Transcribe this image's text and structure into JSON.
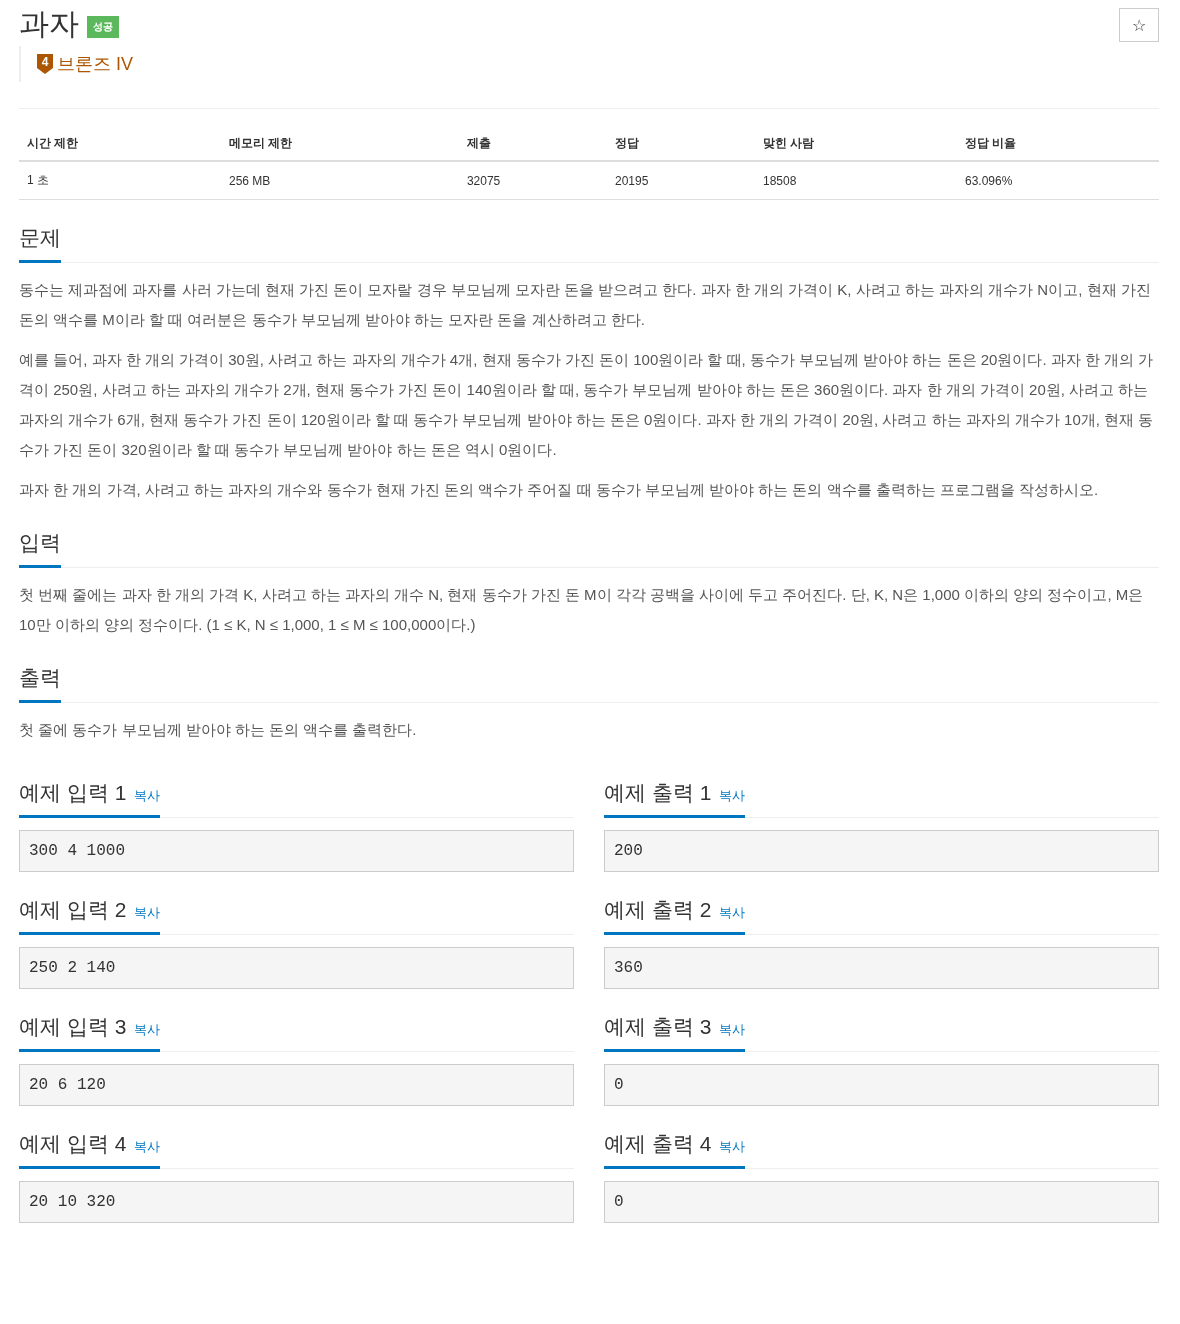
{
  "title": "과자",
  "result_badge": "성공",
  "tier": {
    "number": "4",
    "label": "브론즈 IV"
  },
  "star_button": "☆",
  "stats": {
    "columns": [
      "시간 제한",
      "메모리 제한",
      "제출",
      "정답",
      "맞힌 사람",
      "정답 비율"
    ],
    "row": [
      "1 초",
      "256 MB",
      "32075",
      "20195",
      "18508",
      "63.096%"
    ]
  },
  "sections": [
    {
      "heading": "문제",
      "paragraphs": [
        "동수는 제과점에 과자를 사러 가는데 현재 가진 돈이 모자랄 경우 부모님께 모자란 돈을 받으려고 한다. 과자 한 개의 가격이 K, 사려고 하는 과자의 개수가 N이고, 현재 가진 돈의 액수를 M이라 할 때 여러분은 동수가 부모님께 받아야 하는 모자란 돈을 계산하려고 한다.",
        "예를 들어, 과자 한 개의 가격이 30원, 사려고 하는 과자의 개수가 4개, 현재 동수가 가진 돈이 100원이라 할 때, 동수가 부모님께 받아야 하는 돈은 20원이다. 과자 한 개의 가격이 250원, 사려고 하는 과자의 개수가 2개, 현재 동수가 가진 돈이 140원이라 할 때, 동수가 부모님께 받아야 하는 돈은 360원이다. 과자 한 개의 가격이 20원, 사려고 하는 과자의 개수가 6개, 현재 동수가 가진 돈이 120원이라 할 때 동수가 부모님께 받아야 하는 돈은 0원이다. 과자 한 개의 가격이 20원, 사려고 하는 과자의 개수가 10개, 현재 동수가 가진 돈이 320원이라 할 때 동수가 부모님께 받아야 하는 돈은 역시 0원이다.",
        "과자 한 개의 가격, 사려고 하는 과자의 개수와 동수가 현재 가진 돈의 액수가 주어질 때 동수가 부모님께 받아야 하는 돈의 액수를 출력하는 프로그램을 작성하시오."
      ]
    },
    {
      "heading": "입력",
      "paragraphs": [
        "첫 번째 줄에는 과자 한 개의 가격 K, 사려고 하는 과자의 개수 N, 현재 동수가 가진 돈 M이 각각 공백을 사이에 두고 주어진다. 단, K, N은 1,000 이하의 양의 정수이고, M은 10만 이하의 양의 정수이다. (1 ≤ K, N ≤ 1,000, 1 ≤ M ≤ 100,000이다.)"
      ]
    },
    {
      "heading": "출력",
      "paragraphs": [
        "첫 줄에 동수가 부모님께 받아야 하는 돈의 액수를 출력한다."
      ]
    }
  ],
  "samples": [
    {
      "input_heading": "예제 입력 1",
      "input_copy": "복사",
      "input": "300 4 1000",
      "output_heading": "예제 출력 1",
      "output_copy": "복사",
      "output": "200"
    },
    {
      "input_heading": "예제 입력 2",
      "input_copy": "복사",
      "input": "250 2 140",
      "output_heading": "예제 출력 2",
      "output_copy": "복사",
      "output": "360"
    },
    {
      "input_heading": "예제 입력 3",
      "input_copy": "복사",
      "input": "20 6 120",
      "output_heading": "예제 출력 3",
      "output_copy": "복사",
      "output": "0"
    },
    {
      "input_heading": "예제 입력 4",
      "input_copy": "복사",
      "input": "20 10 320",
      "output_heading": "예제 출력 4",
      "output_copy": "복사",
      "output": "0"
    }
  ]
}
